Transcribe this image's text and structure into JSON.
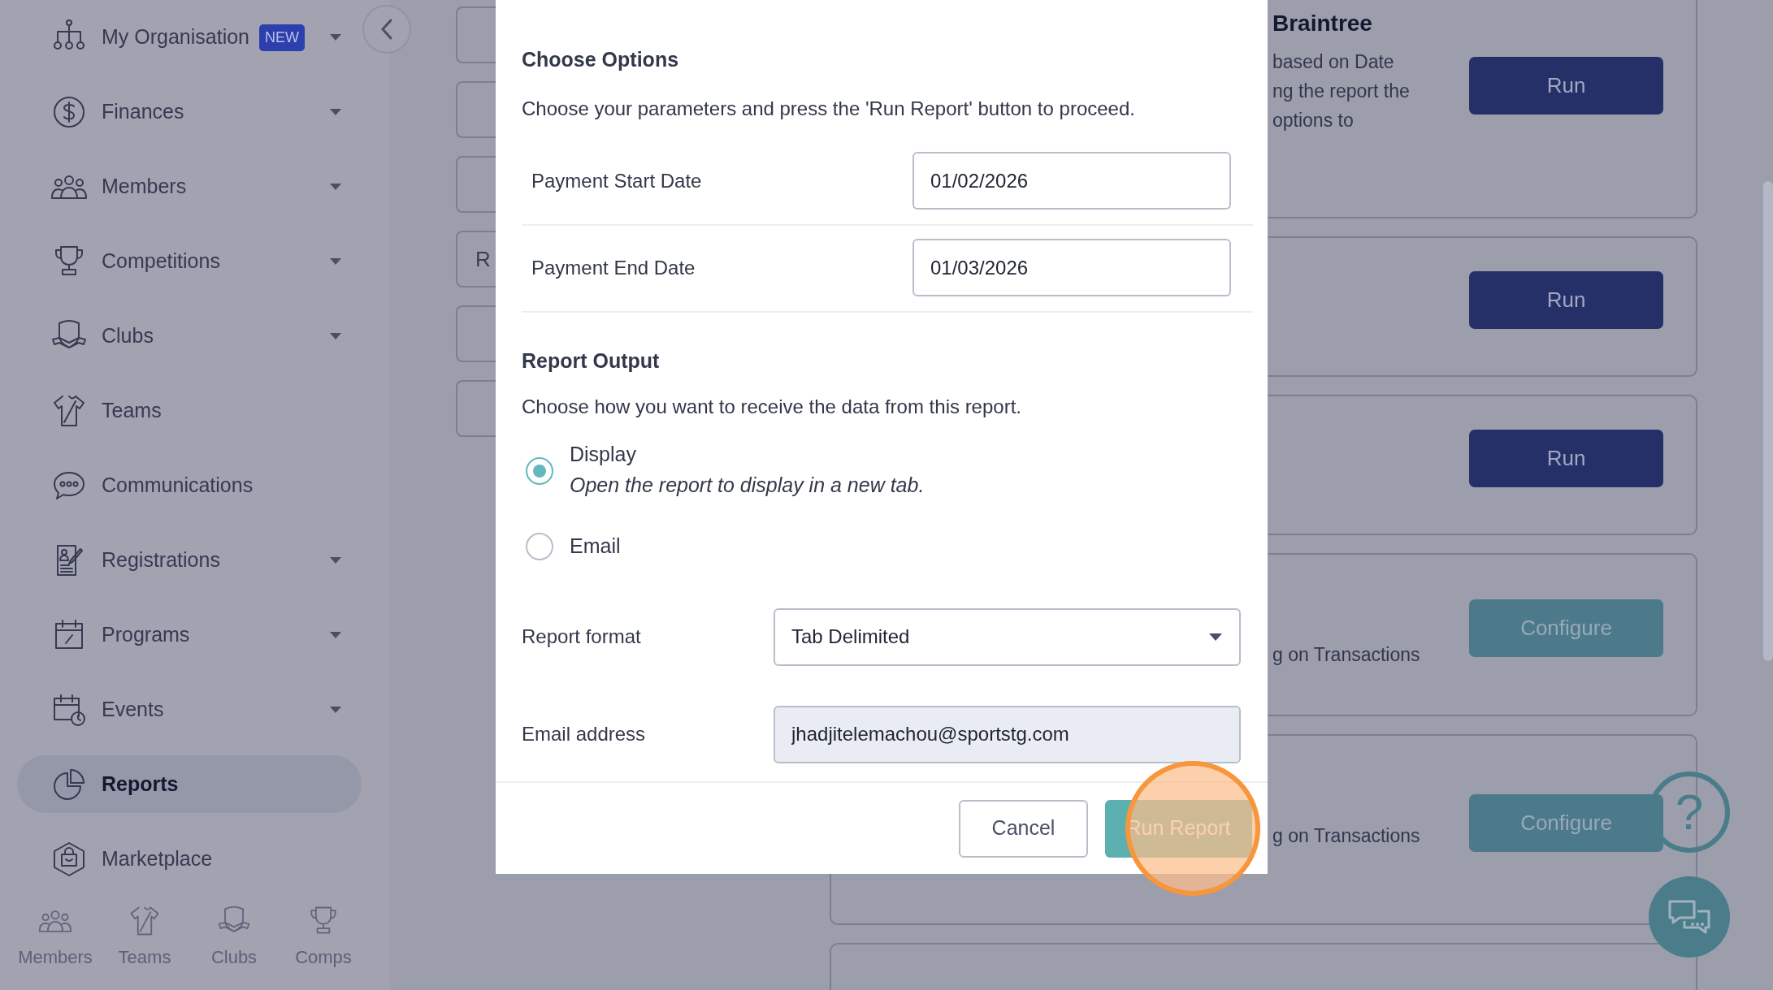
{
  "sidebar": {
    "items": [
      {
        "label": "My Organisation",
        "badge": "NEW",
        "expandable": true,
        "selected": false
      },
      {
        "label": "Finances",
        "expandable": true,
        "selected": false
      },
      {
        "label": "Members",
        "expandable": true,
        "selected": false
      },
      {
        "label": "Competitions",
        "expandable": true,
        "selected": false
      },
      {
        "label": "Clubs",
        "expandable": true,
        "selected": false
      },
      {
        "label": "Teams",
        "expandable": false,
        "selected": false
      },
      {
        "label": "Communications",
        "expandable": false,
        "selected": false
      },
      {
        "label": "Registrations",
        "expandable": true,
        "selected": false
      },
      {
        "label": "Programs",
        "expandable": true,
        "selected": false
      },
      {
        "label": "Events",
        "expandable": true,
        "selected": false
      },
      {
        "label": "Reports",
        "expandable": false,
        "selected": true
      },
      {
        "label": "Marketplace",
        "expandable": false,
        "selected": false
      }
    ],
    "bottom_nav": [
      {
        "label": "Members"
      },
      {
        "label": "Teams"
      },
      {
        "label": "Clubs"
      },
      {
        "label": "Comps"
      }
    ]
  },
  "side_tab_text": "R",
  "report_cards": [
    {
      "title": "Braintree",
      "description_lines": [
        "based on Date",
        "ng the report the",
        "options to"
      ],
      "button": {
        "label": "Run",
        "kind": "primary"
      }
    },
    {
      "button": {
        "label": "Run",
        "kind": "primary"
      }
    },
    {
      "button": {
        "label": "Run",
        "kind": "primary"
      }
    },
    {
      "description_lines": [
        "g on Transactions"
      ],
      "button": {
        "label": "Configure",
        "kind": "secondary"
      }
    },
    {
      "description_lines": [
        "g on Transactions"
      ],
      "button": {
        "label": "Configure",
        "kind": "secondary"
      }
    }
  ],
  "modal": {
    "section_title": "Choose Options",
    "instructions": "Choose your parameters and press the 'Run Report' button to proceed.",
    "date_fields": [
      {
        "label": "Payment Start Date",
        "value": "01/02/2026"
      },
      {
        "label": "Payment End Date",
        "value": "01/03/2026"
      }
    ],
    "output_title": "Report Output",
    "output_description": "Choose how you want to receive the data from this report.",
    "output_options": [
      {
        "label": "Display",
        "description": "Open the report to display in a new tab.",
        "selected": true
      },
      {
        "label": "Email",
        "selected": false
      }
    ],
    "format": {
      "label": "Report format",
      "value": "Tab Delimited"
    },
    "email": {
      "label": "Email address",
      "value": "jhadjitelemachou@sportstg.com",
      "readonly": true
    },
    "buttons": [
      {
        "label": "Cancel",
        "kind": "secondary"
      },
      {
        "label": "Run Report",
        "kind": "primary"
      }
    ]
  },
  "help_button": {
    "label": "?"
  }
}
